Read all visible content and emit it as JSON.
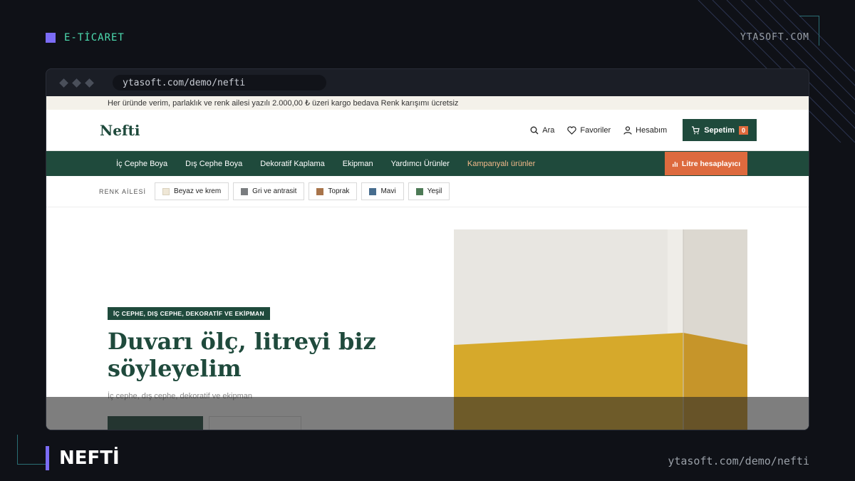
{
  "top_label": "E-TİCARET",
  "brand": "YTASOFT.COM",
  "bottom_title": "NEFTİ",
  "bottom_url": "ytasoft.com/demo/nefti",
  "browser": {
    "url": "ytasoft.com/demo/nefti"
  },
  "site": {
    "announcement": "Her üründe verim, parlaklık ve renk ailesi yazılı 2.000,00 ₺ üzeri kargo bedava Renk karışımı ücretsiz",
    "logo": "Nefti",
    "header": {
      "search_label": "Ara",
      "favorites_label": "Favoriler",
      "account_label": "Hesabım",
      "cart_label": "Sepetim",
      "cart_count": "0"
    },
    "nav": {
      "items": [
        {
          "label": "İç Cephe Boya"
        },
        {
          "label": "Dış Cephe Boya"
        },
        {
          "label": "Dekoratif Kaplama"
        },
        {
          "label": "Ekipman"
        },
        {
          "label": "Yardımcı Ürünler"
        },
        {
          "label": "Kampanyalı ürünler"
        }
      ],
      "litre_button": "Litre hesaplayıcı"
    },
    "color_family": {
      "label": "RENK AİLESİ",
      "chips": [
        {
          "label": "Beyaz ve krem",
          "color": "#efe7d6"
        },
        {
          "label": "Gri ve antrasit",
          "color": "#7a7d80"
        },
        {
          "label": "Toprak",
          "color": "#a8744a"
        },
        {
          "label": "Mavi",
          "color": "#476d8e"
        },
        {
          "label": "Yeşil",
          "color": "#4d7a56"
        }
      ]
    },
    "hero": {
      "badge": "İÇ CEPHE, DIŞ CEPHE, DEKORATİF VE EKİPMAN",
      "title": "Duvarı ölç, litreyi biz söyleyelim",
      "subtitle": "İç cephe, dış cephe, dekoratif ve ekipman"
    }
  },
  "colors": {
    "accent_green": "#1f4a3c",
    "accent_orange": "#dd6a3e",
    "label_mint": "#4ddcb0",
    "label_purple": "#7b6cf6"
  }
}
